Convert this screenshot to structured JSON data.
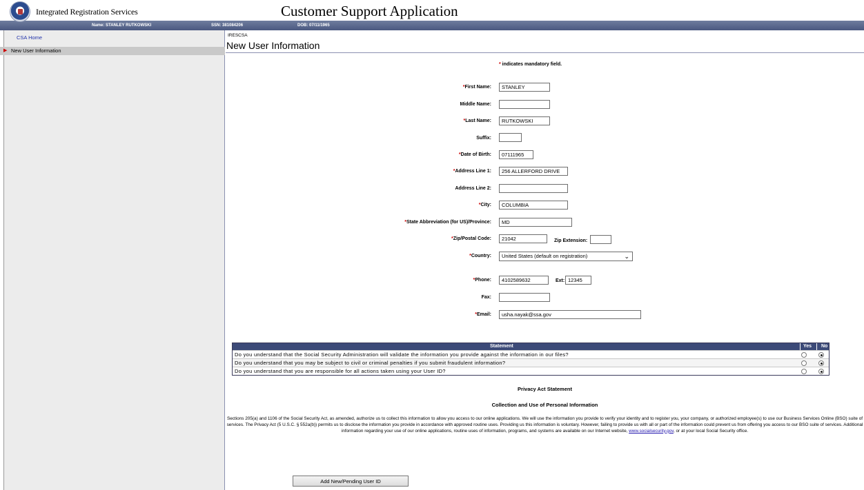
{
  "header": {
    "org_name": "Integrated Registration Services",
    "app_title": "Customer Support Application",
    "name_label": "Name: STANLEY RUTKOWSKI",
    "ssn_label": "SSN: 381084206",
    "dob_label": "DOB: 07/11/1965"
  },
  "sidebar": {
    "home_link": "CSA Home",
    "selected_item": "New User Information"
  },
  "page": {
    "code": "IRESCSA",
    "title": "New User Information",
    "mandatory_note_star": "*",
    "mandatory_note": " indicates mandatory field."
  },
  "form": {
    "first_name": {
      "label": "First Name:",
      "value": "STANLEY",
      "required": true
    },
    "middle_name": {
      "label": "Middle Name:",
      "value": ""
    },
    "last_name": {
      "label": "Last Name:",
      "value": "RUTKOWSKI",
      "required": true
    },
    "suffix": {
      "label": "Suffix:",
      "value": ""
    },
    "dob": {
      "label": "Date of Birth:",
      "value": "07111965",
      "required": true
    },
    "address1": {
      "label": "Address Line 1:",
      "value": "256 ALLERFORD DRIVE",
      "required": true
    },
    "address2": {
      "label": "Address Line 2:",
      "value": ""
    },
    "city": {
      "label": "City:",
      "value": "COLUMBIA",
      "required": true
    },
    "state": {
      "label": "State Abbreviation (for US)/Province:",
      "value": "MD",
      "required": true
    },
    "zip": {
      "label": "Zip/Postal Code:",
      "value": "21042",
      "required": true
    },
    "zip_ext": {
      "label": "Zip Extension:",
      "value": ""
    },
    "country": {
      "label": "Country:",
      "value": "United States (default on registration)",
      "required": true
    },
    "phone": {
      "label": "Phone:",
      "value": "4102589632",
      "required": true
    },
    "ext": {
      "label": "Ext:",
      "value": "12345"
    },
    "fax": {
      "label": "Fax:",
      "value": ""
    },
    "email": {
      "label": "Email:",
      "value": "usha.nayak@ssa.gov",
      "required": true
    },
    "req_star": "*"
  },
  "statements": {
    "header": "Statement",
    "yes": "Yes",
    "no": "No",
    "rows": [
      {
        "text": "Do you understand that the Social Security Administration will validate the information you provide against the information in our files?",
        "answer": "No"
      },
      {
        "text": "Do you understand that you may be subject to civil or criminal penalties if you submit fraudulent information?",
        "answer": "No"
      },
      {
        "text": "Do you understand that you are responsible for all actions taken using your User ID?",
        "answer": "No"
      }
    ]
  },
  "privacy": {
    "title": "Privacy Act Statement",
    "subtitle": "Collection and Use of Personal Information",
    "text": "Sections 205(a) and 1106 of the Social Security Act, as amended, authorize us to collect this information to allow you access to our online applications. We will use the information you provide to verify your identity and to register you, your company, or authorized employee(s) to use our Business Services Online (BSO) suite of services. The Privacy Act (5 U.S.C. § 552a(b)) permits us to disclose the information you provide in accordance with approved routine uses. Providing us this information is voluntary. However, failing to provide us with all or part of the information could prevent us from offering you access to our BSO suite of services. Additional information regarding your use of our online applications, routine uses of information, programs, and systems are available on our Internet website, ",
    "link": "www.socialsecurity.gov",
    "text_end": ", or at your local Social Security office."
  },
  "actions": {
    "submit": "Add New/Pending User ID"
  }
}
